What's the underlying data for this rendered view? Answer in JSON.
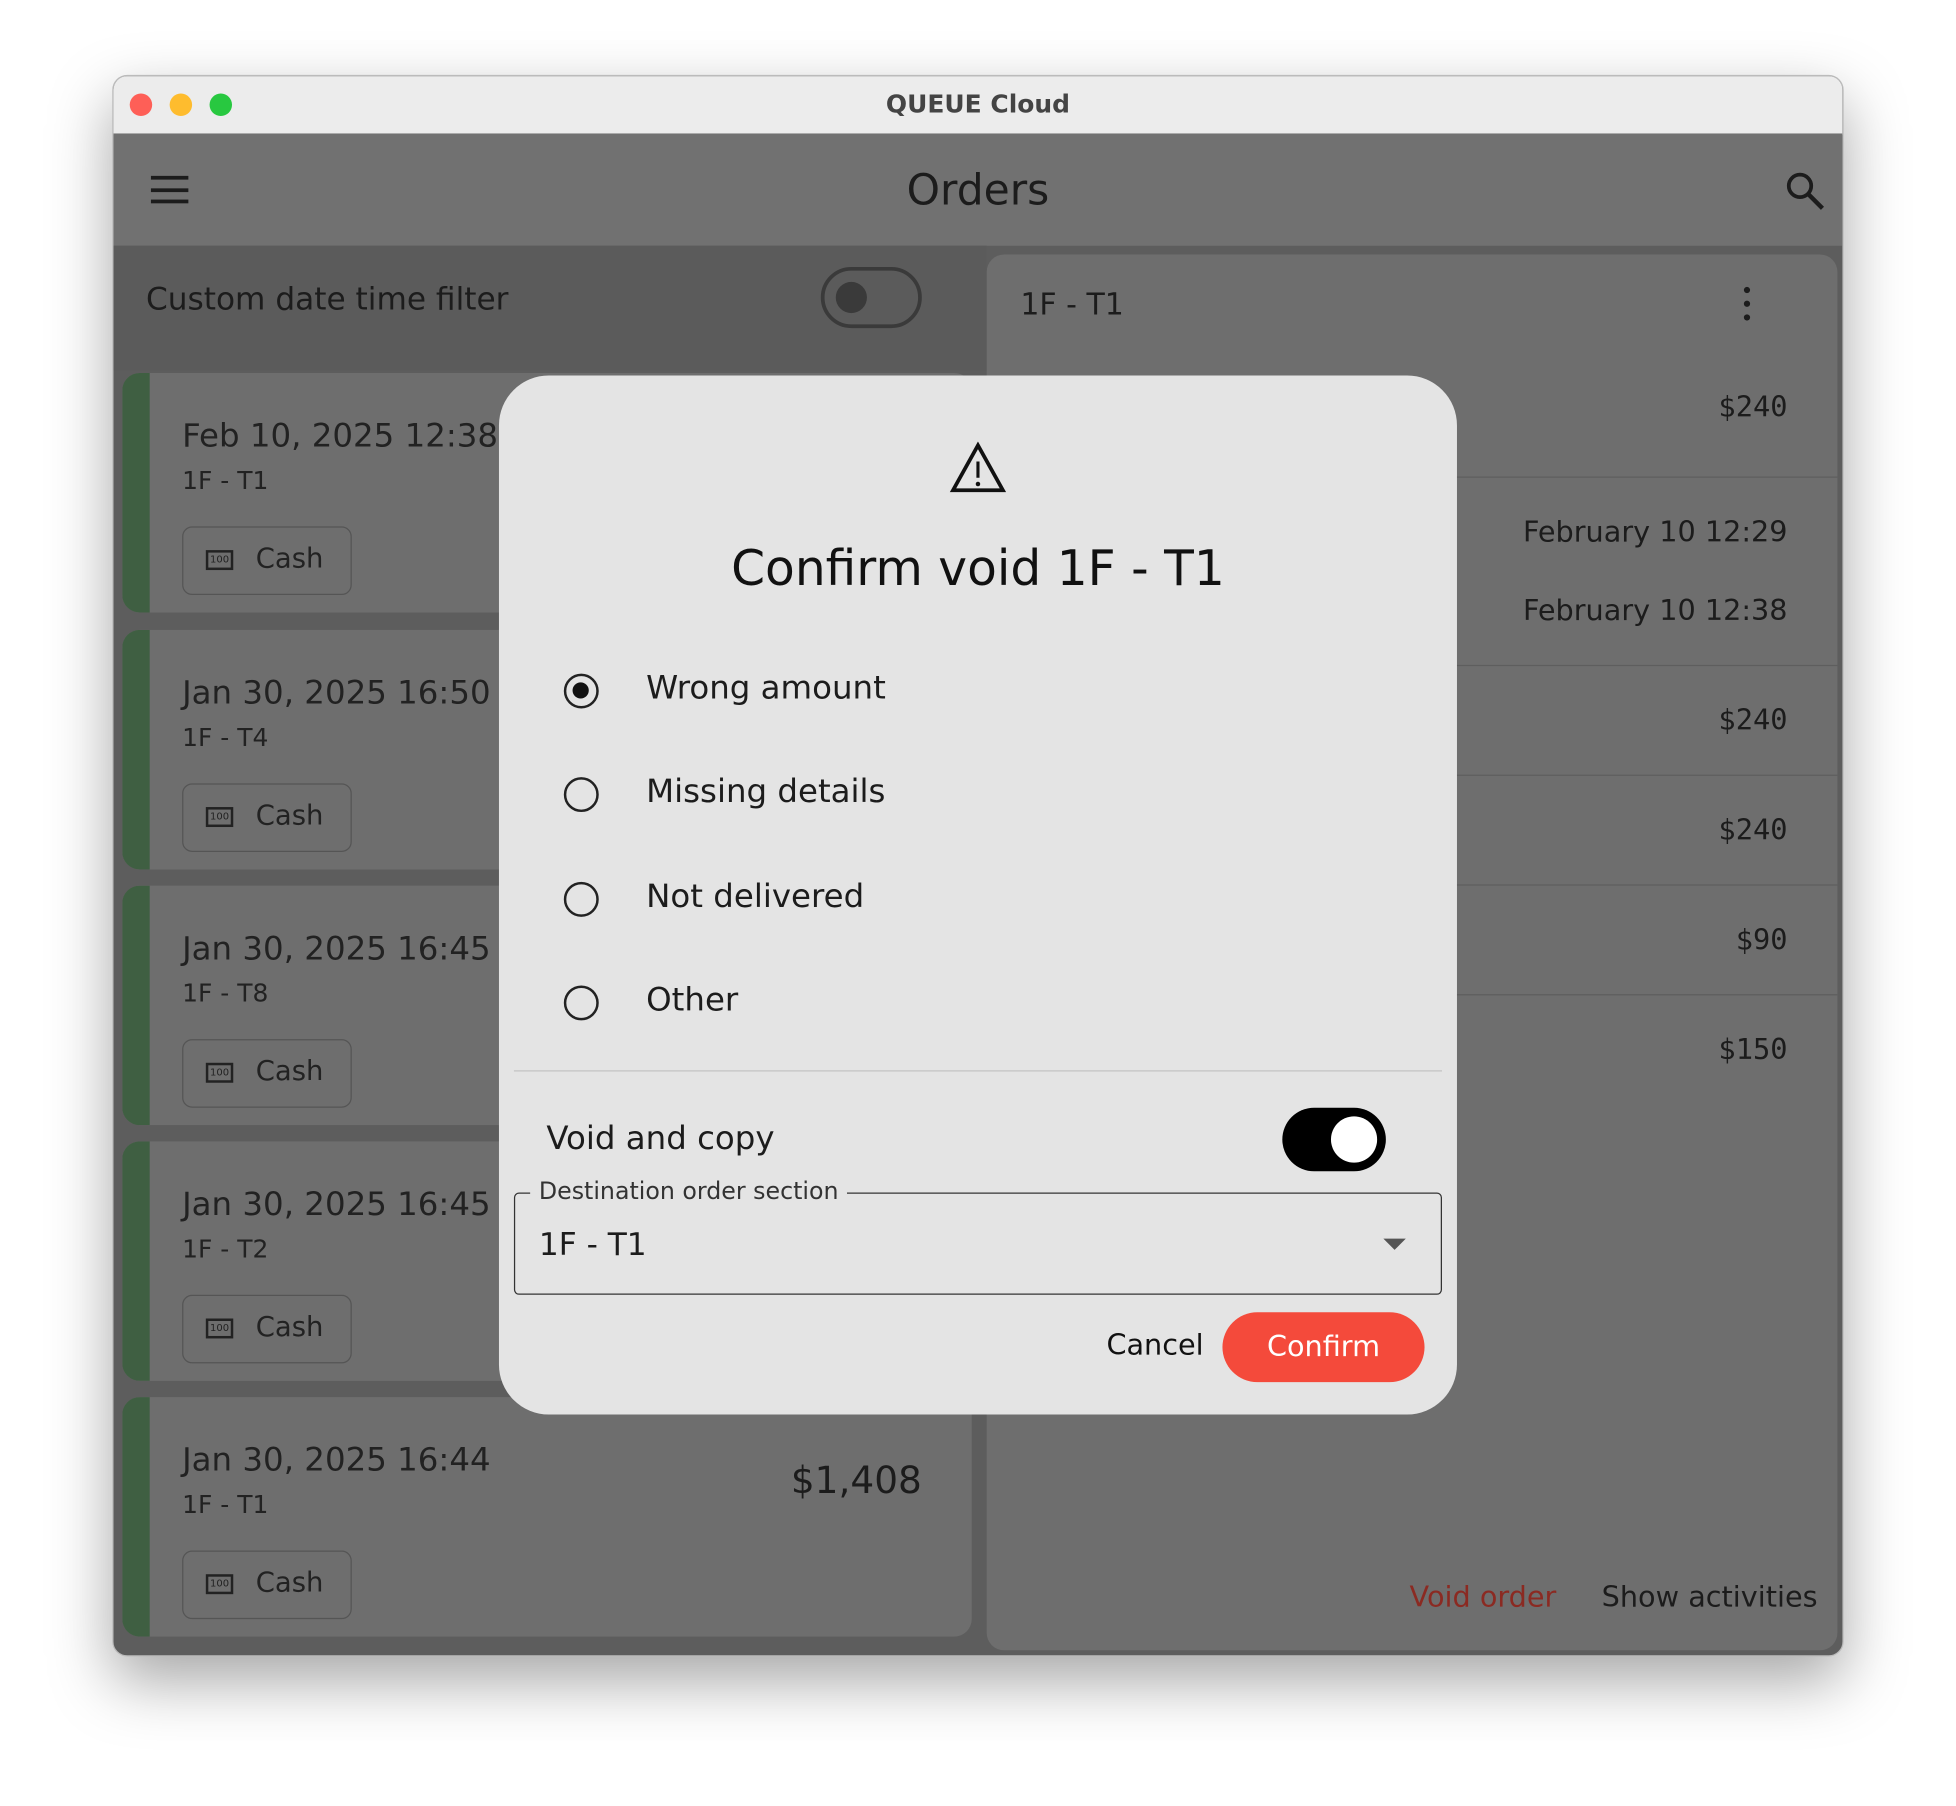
{
  "window": {
    "title": "QUEUE Cloud"
  },
  "appbar": {
    "title": "Orders",
    "menu_icon": "menu-icon",
    "search_icon": "search-icon"
  },
  "filter": {
    "label": "Custom date time filter",
    "enabled": false
  },
  "orders": [
    {
      "date": "Feb 10, 2025 12:38",
      "table": "1F - T1",
      "payment": "Cash",
      "amount": ""
    },
    {
      "date": "Jan 30, 2025 16:50",
      "table": "1F - T4",
      "payment": "Cash",
      "amount": ""
    },
    {
      "date": "Jan 30, 2025 16:45",
      "table": "1F - T8",
      "payment": "Cash",
      "amount": ""
    },
    {
      "date": "Jan 30, 2025 16:45",
      "table": "1F - T2",
      "payment": "Cash",
      "amount": ""
    },
    {
      "date": "Jan 30, 2025 16:44",
      "table": "1F - T1",
      "payment": "Cash",
      "amount": "$1,408"
    }
  ],
  "detail": {
    "title": "1F - T1",
    "rows": [
      "$240",
      "February 10 12:29",
      "February 10 12:38",
      "$240",
      "$240",
      "$90",
      "$150"
    ],
    "void_label": "Void order",
    "activities_label": "Show activities",
    "void_color": "#8b2a22"
  },
  "dialog": {
    "title": "Confirm void 1F - T1",
    "icon": "warning-icon",
    "reasons": [
      {
        "label": "Wrong amount",
        "selected": true
      },
      {
        "label": "Missing details",
        "selected": false
      },
      {
        "label": "Not delivered",
        "selected": false
      },
      {
        "label": "Other",
        "selected": false
      }
    ],
    "void_copy_label": "Void and copy",
    "void_copy_enabled": true,
    "destination_label": "Destination order section",
    "destination_value": "1F - T1",
    "cancel_label": "Cancel",
    "confirm_label": "Confirm",
    "confirm_color": "#f44a3b"
  }
}
